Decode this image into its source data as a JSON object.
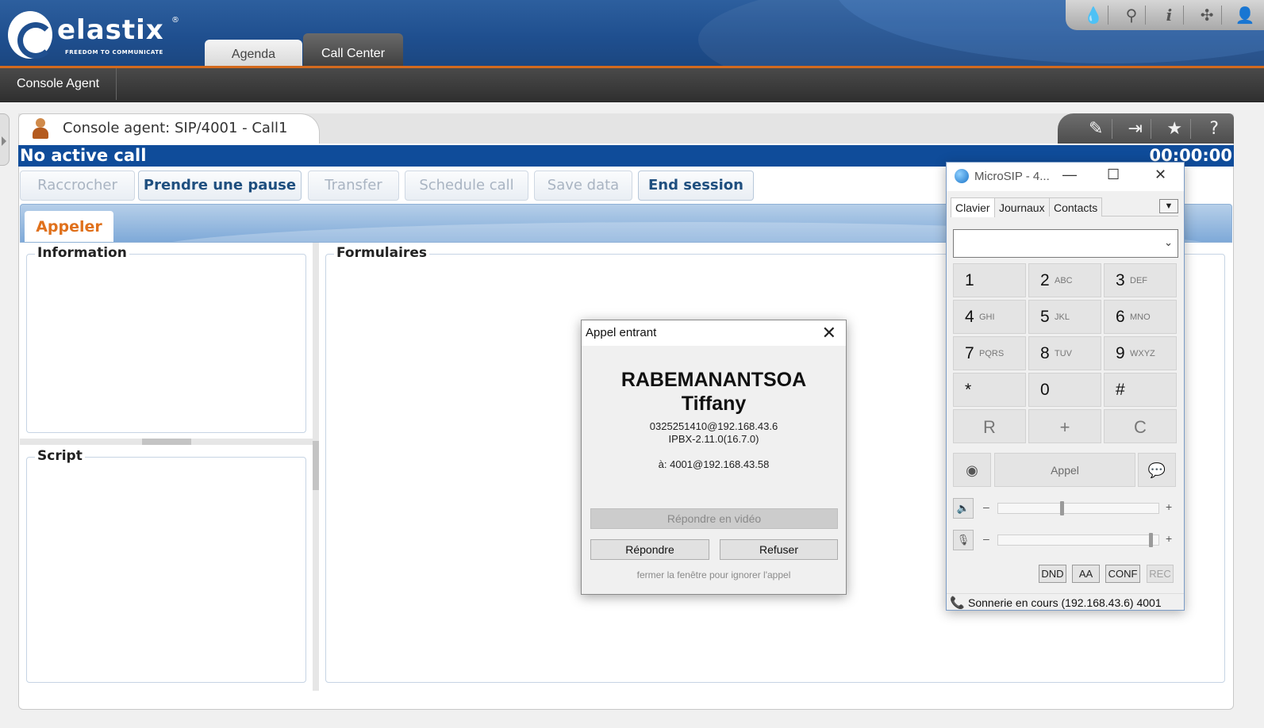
{
  "header": {
    "logo_text": "elastix",
    "logo_tagline": "FREEDOM TO COMMUNICATE",
    "tabs": [
      {
        "label": "Agenda"
      },
      {
        "label": "Call Center"
      }
    ],
    "tool_icons": [
      "drop-icon",
      "search-icon",
      "info-icon",
      "puzzle-icon",
      "user-icon"
    ]
  },
  "subnav": {
    "items": [
      {
        "label": "Console Agent"
      }
    ]
  },
  "module": {
    "title": "Console agent: SIP/4001 - Call1",
    "tool_icons": [
      "edit-icon",
      "logout-icon",
      "star-icon",
      "help-icon"
    ]
  },
  "status": {
    "text": "No active call",
    "timer": "00:00:00"
  },
  "actions": [
    {
      "label": "Raccrocher",
      "enabled": false
    },
    {
      "label": "Prendre une pause",
      "enabled": true
    },
    {
      "label": "Transfer",
      "enabled": false
    },
    {
      "label": "Schedule call",
      "enabled": false
    },
    {
      "label": "Save data",
      "enabled": false
    },
    {
      "label": "End session",
      "enabled": true
    }
  ],
  "tabs": {
    "active": "Appeler"
  },
  "panels": {
    "information": "Information",
    "script": "Script",
    "formulaires": "Formulaires"
  },
  "incoming_call": {
    "title": "Appel entrant",
    "caller_first": "RABEMANANTSOA",
    "caller_last": "Tiffany",
    "caller_uri": "0325251410@192.168.43.6",
    "caller_agent": "IPBX-2.11.0(16.7.0)",
    "to": "à: 4001@192.168.43.58",
    "btn_video": "Répondre en vidéo",
    "btn_answer": "Répondre",
    "btn_reject": "Refuser",
    "hint": "fermer la fenêtre pour ignorer l'appel"
  },
  "microsip": {
    "title": "MicroSIP - 4...",
    "tabs": [
      "Clavier",
      "Journaux",
      "Contacts"
    ],
    "number_value": "",
    "keys": [
      {
        "digit": "1",
        "letters": ""
      },
      {
        "digit": "2",
        "letters": "ABC"
      },
      {
        "digit": "3",
        "letters": "DEF"
      },
      {
        "digit": "4",
        "letters": "GHI"
      },
      {
        "digit": "5",
        "letters": "JKL"
      },
      {
        "digit": "6",
        "letters": "MNO"
      },
      {
        "digit": "7",
        "letters": "PQRS"
      },
      {
        "digit": "8",
        "letters": "TUV"
      },
      {
        "digit": "9",
        "letters": "WXYZ"
      },
      {
        "digit": "*",
        "letters": ""
      },
      {
        "digit": "0",
        "letters": ""
      },
      {
        "digit": "#",
        "letters": ""
      },
      {
        "digit": "R",
        "letters": ""
      },
      {
        "digit": "+",
        "letters": ""
      },
      {
        "digit": "C",
        "letters": ""
      }
    ],
    "call_label": "Appel",
    "speaker_volume": 0.4,
    "mic_volume": 0.97,
    "vol_minus": "–",
    "vol_plus": "+",
    "options": [
      "DND",
      "AA",
      "CONF",
      "REC"
    ],
    "status_text": "Sonnerie en cours (192.168.43.6) 4001"
  }
}
